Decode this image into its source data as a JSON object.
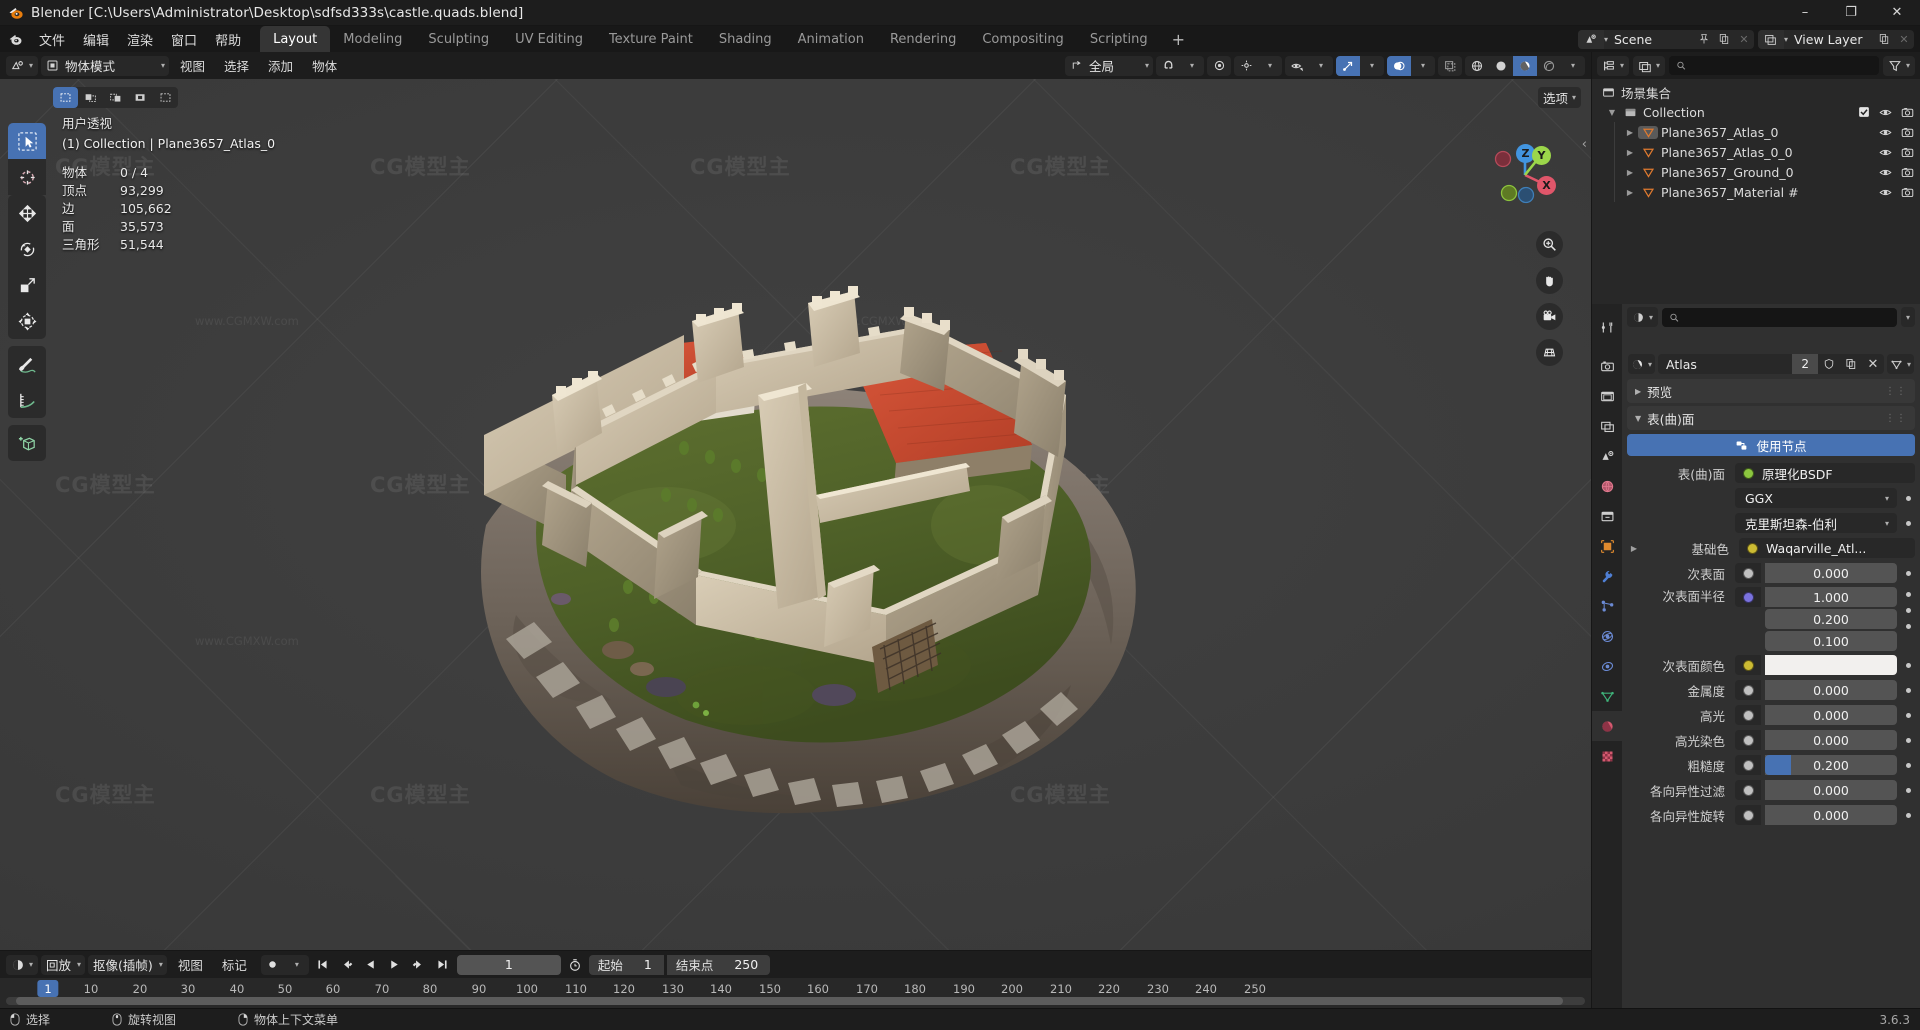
{
  "window": {
    "title": "Blender [C:\\Users\\Administrator\\Desktop\\sdfsd333s\\castle.quads.blend]",
    "minimize": "–",
    "maximize": "❐",
    "close": "✕"
  },
  "topbar": {
    "menus": [
      "文件",
      "编辑",
      "渲染",
      "窗口",
      "帮助"
    ],
    "workspaces": [
      {
        "label": "Layout",
        "active": true
      },
      {
        "label": "Modeling",
        "active": false
      },
      {
        "label": "Sculpting",
        "active": false
      },
      {
        "label": "UV Editing",
        "active": false
      },
      {
        "label": "Texture Paint",
        "active": false
      },
      {
        "label": "Shading",
        "active": false
      },
      {
        "label": "Animation",
        "active": false
      },
      {
        "label": "Rendering",
        "active": false
      },
      {
        "label": "Compositing",
        "active": false
      },
      {
        "label": "Scripting",
        "active": false
      }
    ],
    "add_workspace": "+",
    "scene_name": "Scene",
    "viewlayer_name": "View Layer"
  },
  "viewport_header": {
    "mode": "物体模式",
    "menus": [
      "视图",
      "选择",
      "添加",
      "物体"
    ],
    "transform_orientation": "全局"
  },
  "viewport": {
    "view_name": "用户透视",
    "collection_line": "(1) Collection | Plane3657_Atlas_0",
    "options_label": "选项",
    "stats": [
      {
        "key": "物体",
        "value": "0 / 4"
      },
      {
        "key": "顶点",
        "value": "93,299"
      },
      {
        "key": "边",
        "value": "105,662"
      },
      {
        "key": "面",
        "value": "35,573"
      },
      {
        "key": "三角形",
        "value": "51,544"
      }
    ],
    "gizmo_axes": [
      {
        "label": "X",
        "color": "#e0566a"
      },
      {
        "label": "Y",
        "color": "#9bd64a"
      },
      {
        "label": "Z",
        "color": "#4295e0"
      }
    ]
  },
  "timeline": {
    "editor_menu_icon": "clock-icon",
    "menus": [
      "回放",
      "抠像(插帧)",
      "视图",
      "标记"
    ],
    "current_frame": "1",
    "start_label": "起始",
    "start_value": "1",
    "end_label": "结束点",
    "end_value": "250",
    "ticks": [
      "1",
      "10",
      "20",
      "30",
      "40",
      "50",
      "60",
      "70",
      "80",
      "90",
      "100",
      "110",
      "120",
      "130",
      "140",
      "150",
      "160",
      "170",
      "180",
      "190",
      "200",
      "210",
      "220",
      "230",
      "240",
      "250"
    ],
    "playhead_frame": "1"
  },
  "outliner": {
    "display_mode": "视图层",
    "search_placeholder": "",
    "scene_collection": "场景集合",
    "rows": [
      {
        "name": "Collection",
        "indent": 1,
        "type": "collection",
        "expanded": true,
        "checkbox": true,
        "active": false
      },
      {
        "name": "Plane3657_Atlas_0",
        "indent": 2,
        "type": "mesh",
        "expanded": false,
        "checkbox": false,
        "active": true
      },
      {
        "name": "Plane3657_Atlas_0_0",
        "indent": 2,
        "type": "mesh",
        "expanded": false,
        "checkbox": false,
        "active": false
      },
      {
        "name": "Plane3657_Ground_0",
        "indent": 2,
        "type": "mesh",
        "expanded": false,
        "checkbox": false,
        "active": false
      },
      {
        "name": "Plane3657_Material #",
        "indent": 2,
        "type": "mesh",
        "expanded": false,
        "checkbox": false,
        "active": false
      }
    ]
  },
  "properties": {
    "tabs": [
      {
        "name": "tool",
        "icon": "wrench-screwdriver-icon",
        "active": false
      },
      {
        "name": "render",
        "icon": "camera-back-icon",
        "active": false
      },
      {
        "name": "output",
        "icon": "printer-icon",
        "active": false
      },
      {
        "name": "view-layer",
        "icon": "images-icon",
        "active": false
      },
      {
        "name": "scene",
        "icon": "cone-sphere-icon",
        "active": false
      },
      {
        "name": "world",
        "icon": "world-icon",
        "active": false
      },
      {
        "name": "collection",
        "icon": "box-icon",
        "active": false
      },
      {
        "name": "object",
        "icon": "orange-square-icon",
        "active": false
      },
      {
        "name": "modifiers",
        "icon": "wrench-icon",
        "active": false
      },
      {
        "name": "particles",
        "icon": "particles-icon",
        "active": false
      },
      {
        "name": "physics",
        "icon": "physics-orbit-icon",
        "active": false
      },
      {
        "name": "constraints",
        "icon": "constraint-icon",
        "active": false
      },
      {
        "name": "data",
        "icon": "green-triangle-mesh-icon",
        "active": false
      },
      {
        "name": "material",
        "icon": "material-sphere-icon",
        "active": true
      },
      {
        "name": "texture",
        "icon": "checker-texture-icon",
        "active": false
      }
    ],
    "search_placeholder": "",
    "material_name": "Atlas",
    "material_users": "2",
    "panels": {
      "preview": "预览",
      "surface": "表(曲)面"
    },
    "use_nodes": "使用节点",
    "rows": [
      {
        "label": "表(曲)面",
        "value": "原理化BSDF",
        "kind": "dropdown-dark",
        "socket": "#8cc63f"
      },
      {
        "label": "",
        "value": "GGX",
        "kind": "dropdown",
        "socket": null
      },
      {
        "label": "",
        "value": "克里斯坦森-伯利",
        "kind": "dropdown",
        "socket": null
      },
      {
        "label": "基础色",
        "value": "Waqarville_Atl...",
        "kind": "link-dark",
        "socket": "#ccbb33",
        "expandable": true
      },
      {
        "label": "次表面",
        "value": "0.000",
        "kind": "value",
        "socket": "#c0c0c0"
      },
      {
        "label": "次表面半径",
        "value": "1.000",
        "kind": "vector",
        "socket": "#7a72de",
        "extra": [
          "0.200",
          "0.100"
        ]
      },
      {
        "label": "次表面颜色",
        "value": "",
        "kind": "color",
        "socket": "#ccbb33",
        "color": "#f2f0ee"
      },
      {
        "label": "金属度",
        "value": "0.000",
        "kind": "value",
        "socket": "#c0c0c0"
      },
      {
        "label": "高光",
        "value": "0.000",
        "kind": "value",
        "socket": "#c0c0c0"
      },
      {
        "label": "高光染色",
        "value": "0.000",
        "kind": "value",
        "socket": "#c0c0c0"
      },
      {
        "label": "粗糙度",
        "value": "0.200",
        "kind": "slider",
        "socket": "#c0c0c0",
        "fill_pct": 20
      },
      {
        "label": "各向异性过滤",
        "value": "0.000",
        "kind": "value",
        "socket": "#c0c0c0"
      },
      {
        "label": "各向异性旋转",
        "value": "0.000",
        "kind": "value",
        "socket": "#c0c0c0"
      }
    ]
  },
  "statusbar": {
    "items": [
      {
        "icon": "mouse-left-icon",
        "label": "选择"
      },
      {
        "icon": "mouse-middle-icon",
        "label": "旋转视图"
      },
      {
        "icon": "mouse-right-icon",
        "label": "物体上下文菜单"
      }
    ],
    "version": "3.6.3"
  },
  "watermark": {
    "big": "CG模型主",
    "small": "www.CGMXW.com"
  },
  "colors": {
    "accent_blue": "#4772b3",
    "bg_dark": "#1d1d1d",
    "panel": "#303030",
    "editor": "#282828",
    "axis_x": "#e0566a",
    "axis_y": "#9bd64a",
    "axis_z": "#4295e0"
  }
}
